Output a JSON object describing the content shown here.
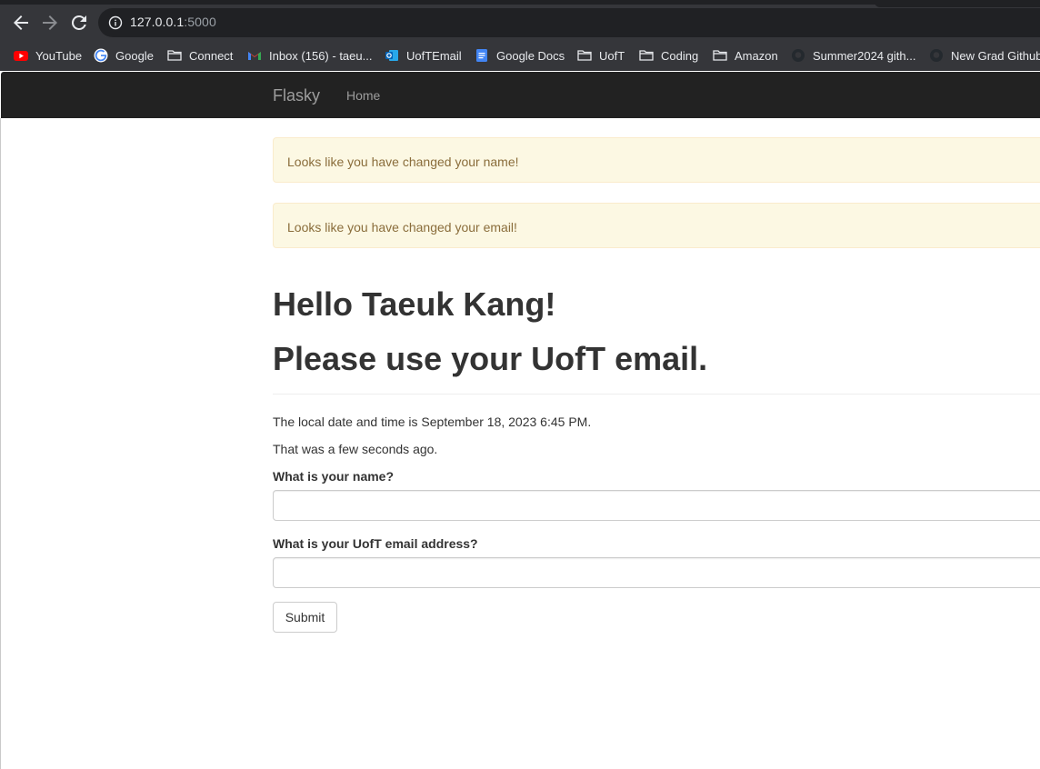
{
  "browser": {
    "url_host": "127.0.0.1",
    "url_port": ":5000",
    "bookmarks": [
      {
        "label": "YouTube",
        "icon": "youtube-icon"
      },
      {
        "label": "Google",
        "icon": "google-icon"
      },
      {
        "label": "Connect",
        "icon": "folder-icon"
      },
      {
        "label": "Inbox (156) - taeu...",
        "icon": "gmail-icon"
      },
      {
        "label": "UofTEmail",
        "icon": "outlook-icon"
      },
      {
        "label": "Google Docs",
        "icon": "google-docs-icon"
      },
      {
        "label": "UofT",
        "icon": "folder-icon"
      },
      {
        "label": "Coding",
        "icon": "folder-icon"
      },
      {
        "label": "Amazon",
        "icon": "folder-icon"
      },
      {
        "label": "Summer2024 gith...",
        "icon": "github-icon"
      },
      {
        "label": "New Grad Github",
        "icon": "github-icon"
      }
    ]
  },
  "navbar": {
    "brand": "Flasky",
    "home": "Home"
  },
  "alerts": [
    "Looks like you have changed your name!",
    "Looks like you have changed your email!"
  ],
  "main": {
    "greeting": "Hello Taeuk Kang!",
    "notice": "Please use your UofT email.",
    "datetime_text": "The local date and time is September 18, 2023 6:45 PM.",
    "relative_text": "That was a few seconds ago."
  },
  "form": {
    "name_label": "What is your name?",
    "name_value": "",
    "email_label": "What is your UofT email address?",
    "email_value": "",
    "submit_label": "Submit"
  },
  "colors": {
    "navbar_bg": "#222222",
    "alert_bg": "#fcf8e3",
    "alert_text": "#8a6d3b",
    "heading_text": "#333333"
  }
}
